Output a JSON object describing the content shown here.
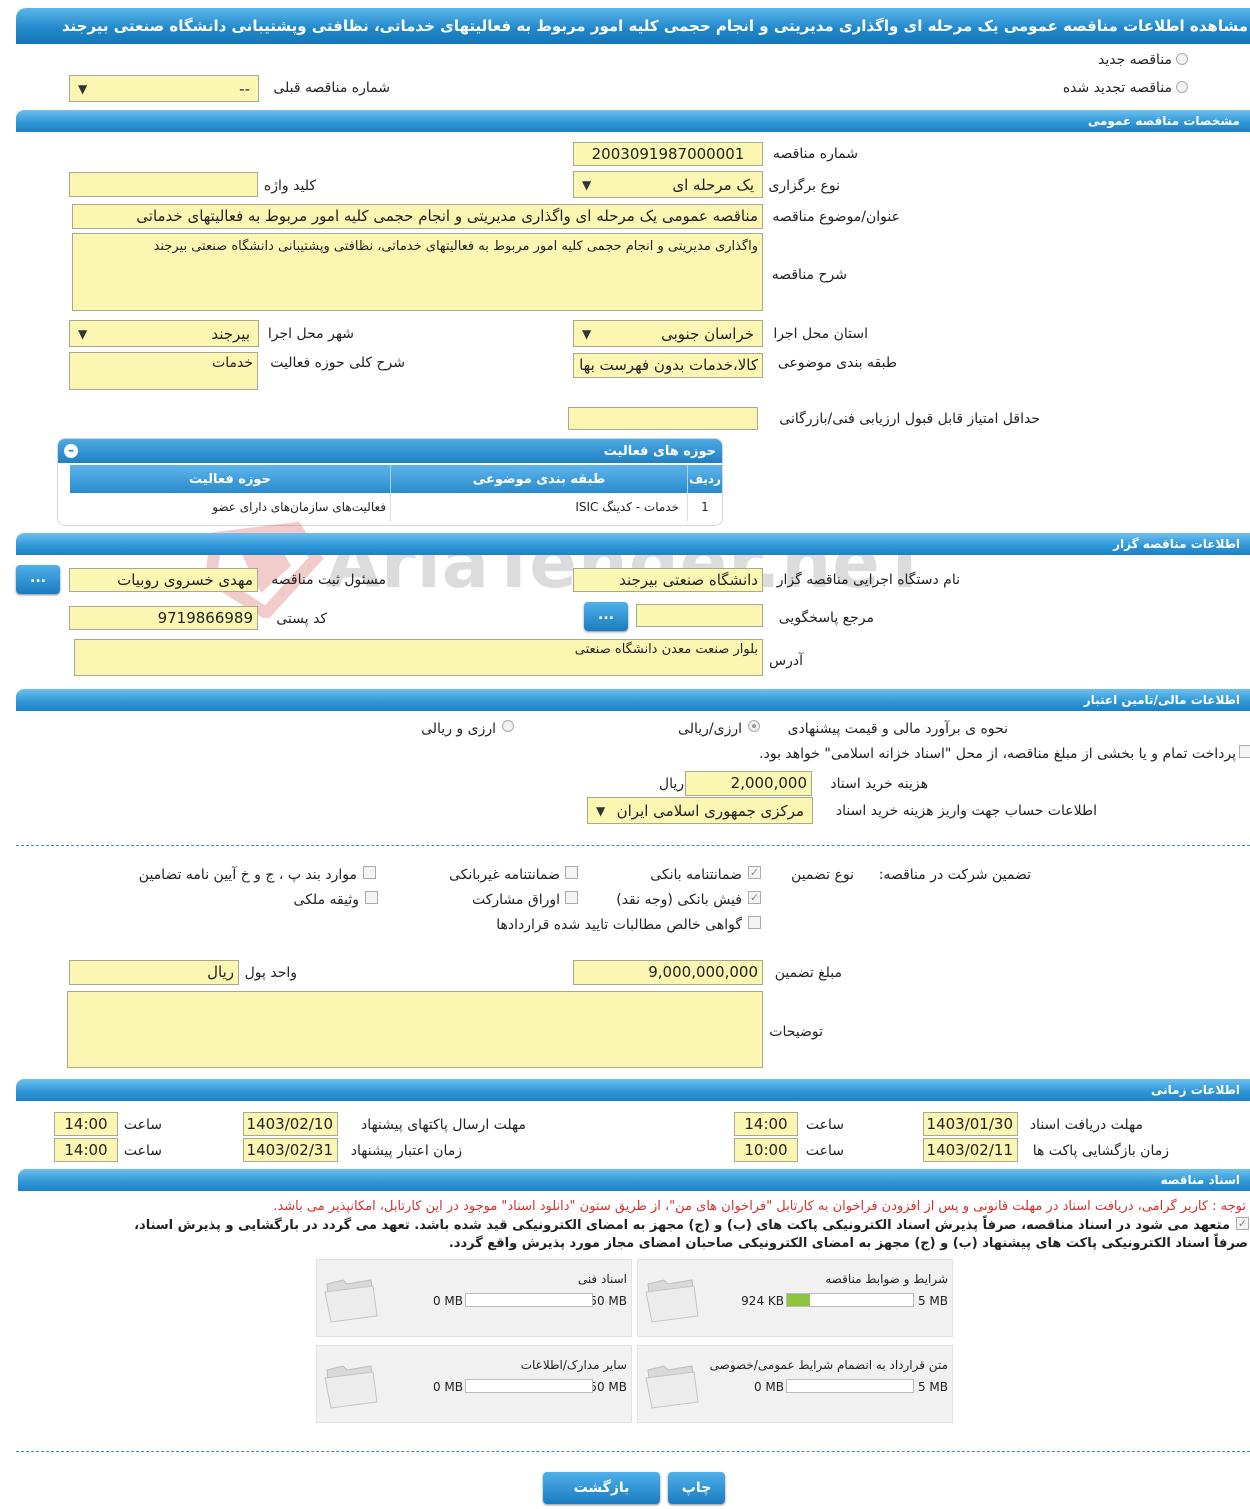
{
  "page": {
    "title": "مشاهده اطلاعات مناقصه عمومی یک مرحله ای واگذاری مدیریتی و انجام حجمی کلیه امور مربوط به فعالیتهای خدماتی، نظافتی وپشتیبانی دانشگاه صنعتی بیرجند"
  },
  "tender_type": {
    "new_label": "مناقصه جدید",
    "renewed_label": "مناقصه تجدید شده",
    "prev_number_label": "شماره مناقصه قبلی",
    "prev_number_value": "--"
  },
  "general": {
    "section_title": "مشخصات مناقصه عمومی",
    "number_label": "شماره مناقصه",
    "number_value": "2003091987000001",
    "holding_type_label": "نوع برگزاری",
    "holding_type_value": "یک مرحله ای",
    "keyword_label": "کلید واژه",
    "keyword_value": "",
    "subject_label": "عنوان/موضوع مناقصه",
    "subject_value": "مناقصه عمومی یک مرحله ای واگذاری مدیریتی و انجام حجمی کلیه امور مربوط به فعالیتهای خدماتی",
    "description_label": "شرح مناقصه",
    "description_value": "واگذاری مدیریتی و انجام حجمی کلیه امور مربوط به فعالیتهای خدماتی، نظافتی وپشتیبانی  دانشگاه صنعتی بیرجند",
    "province_label": "استان محل اجرا",
    "province_value": "خراسان جنوبی",
    "city_label": "شهر محل اجرا",
    "city_value": "بیرجند",
    "category_label": "طبقه بندی موضوعی",
    "category_value": "کالا،خدمات بدون فهرست بها",
    "activity_desc_label": "شرح کلی حوزه فعالیت",
    "activity_desc_value": "خدمات",
    "min_score_label": "حداقل امتیاز قابل قبول ارزیابی فنی/بازرگانی",
    "min_score_value": ""
  },
  "activity_table": {
    "title": "حوزه های فعالیت",
    "headers": [
      "ردیف",
      "طبقه بندی موضوعی",
      "حوزه فعالیت"
    ],
    "rows": [
      [
        "1",
        "خدمات - کدینگ ISIC",
        "فعالیت‌های سازمان‌های دارای عضو"
      ]
    ]
  },
  "organizer": {
    "section_title": "اطلاعات مناقصه گزار",
    "org_label": "نام دستگاه اجرایی مناقصه گزار",
    "org_value": "دانشگاه صنعتی بیرجند",
    "officer_label": "مسئول ثبت مناقصه",
    "officer_value": "مهدی خسروی روبیات",
    "more_button": "...",
    "ref_label": "مرجع پاسخگویی",
    "ref_value": "",
    "postal_label": "کد پستی",
    "postal_value": "9719866989",
    "address_label": "آدرس",
    "address_value": "بلوار صنعت معدن دانشگاه صنعتی"
  },
  "finance": {
    "section_title": "اطلاعات مالی/تامین اعتبار",
    "estimate_label": "نحوه ی برآورد مالی و قیمت پیشنهادی",
    "opt_rial": "ارزی/ریالی",
    "opt_currency": "ارزی و ریالی",
    "treasury_text": "پرداخت تمام و یا بخشی از مبلغ مناقصه، از محل \"اسناد خزانه اسلامی\" خواهد بود.",
    "doc_cost_label": "هزینه خرید اسناد",
    "doc_cost_value": "2,000,000",
    "doc_cost_unit": "ریال",
    "account_label": "اطلاعات حساب جهت واریز هزینه خرید اسناد",
    "account_value": "مرکزی جمهوری اسلامی ایران"
  },
  "guarantee": {
    "participation_label": "تضمین شرکت در مناقصه:",
    "type_label": "نوع تضمین",
    "bank_guarantee": "ضمانتنامه بانکی",
    "nonbank_guarantee": "ضمانتنامه غیربانکی",
    "bylaw_items": "موارد بند پ ، ج و خ آیین نامه تضامین",
    "bank_receipt": "فیش بانکی (وجه نقد)",
    "bonds": "اوراق مشارکت",
    "property": "وثیقه ملکی",
    "claims_cert": "گواهی خالص مطالبات تایید شده قراردادها",
    "amount_label": "مبلغ تضمین",
    "amount_value": "9,000,000,000",
    "currency_label": "واحد پول",
    "currency_value": "ریال",
    "notes_label": "توضیحات",
    "notes_value": ""
  },
  "timing": {
    "section_title": "اطلاعات زمانی",
    "doc_deadline_label": "مهلت دریافت اسناد",
    "doc_deadline_date": "1403/01/30",
    "doc_deadline_time": "14:00",
    "send_deadline_label": "مهلت ارسال پاکتهای پیشنهاد",
    "send_deadline_date": "1403/02/10",
    "send_deadline_time": "14:00",
    "opening_label": "زمان بازگشایی پاکت ها",
    "opening_date": "1403/02/11",
    "opening_time": "10:00",
    "validity_label": "زمان اعتبار پیشنهاد",
    "validity_date": "1403/02/31",
    "validity_time": "14:00",
    "time_label": "ساعت"
  },
  "documents": {
    "section_title": "اسناد مناقصه",
    "notice": "توجه : کاربر گرامی، دریافت اسناد در مهلت قانونی و پس از افزودن فراخوان به کارتابل \"فراخوان های من\"، از طریق ستون \"دانلود اسناد\" موجود در این کارتابل، امکانپذیر می باشد.",
    "commitment_line1": "متعهد می شود در اسناد مناقصه، صرفاً پذیرش اسناد الکترونیکی پاکت های (ب) و (ج) مجهز به امضای الکترونیکی قید شده باشد. تعهد می گردد در بارگشایی و پذیرش اسناد،",
    "commitment_line2": "صرفاً اسناد الکترونیکی پاکت های پیشنهاد (ب) و (ج) مجهز به امضای الکترونیکی صاحبان امضای مجاز مورد پذیرش واقع گردد.",
    "cards": [
      {
        "title": "شرایط و ضوابط مناقصه",
        "current": "924 KB",
        "max": "5 MB",
        "fill": 0.18
      },
      {
        "title": "اسناد فنی",
        "current": "0 MB",
        "max": "50 MB",
        "fill": 0
      },
      {
        "title": "متن قرارداد به انضمام شرایط عمومی/خصوصی",
        "current": "0 MB",
        "max": "5 MB",
        "fill": 0
      },
      {
        "title": "سایر مدارک/اطلاعات",
        "current": "0 MB",
        "max": "50 MB",
        "fill": 0
      }
    ]
  },
  "footer": {
    "print_button": "چاپ",
    "back_button": "بازگشت"
  },
  "watermark": "AriaTender.neT"
}
